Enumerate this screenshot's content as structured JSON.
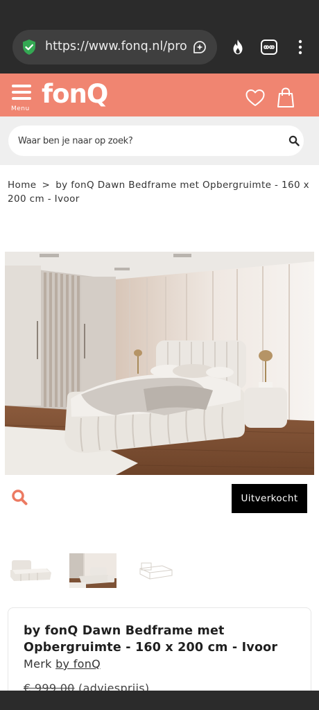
{
  "browser": {
    "url": "https://www.fonq.nl/prod",
    "icons": [
      "shield-check-icon",
      "sparkle-icon",
      "flame-icon",
      "infinity-icon",
      "more-vert-icon"
    ]
  },
  "header": {
    "menu_label": "Menu",
    "logo": "fonQ",
    "icons": [
      "heart-icon",
      "shopping-bag-icon"
    ],
    "brand_color": "#f08571"
  },
  "search": {
    "placeholder": "Waar ben je naar op zoek?"
  },
  "breadcrumb": {
    "home": "Home",
    "separator": ">",
    "current": "by fonQ Dawn Bedframe met Opbergruimte - 160 x 200 cm - Ivoor"
  },
  "product": {
    "status_label": "Uitverkocht",
    "title": "by fonQ Dawn Bedframe met Opbergruimte - 160 x 200 cm - Ivoor",
    "brand_prefix": "Merk",
    "brand_name": "by fonQ",
    "price_old": "€ 999,00",
    "price_note": "(adviesprijs)"
  }
}
